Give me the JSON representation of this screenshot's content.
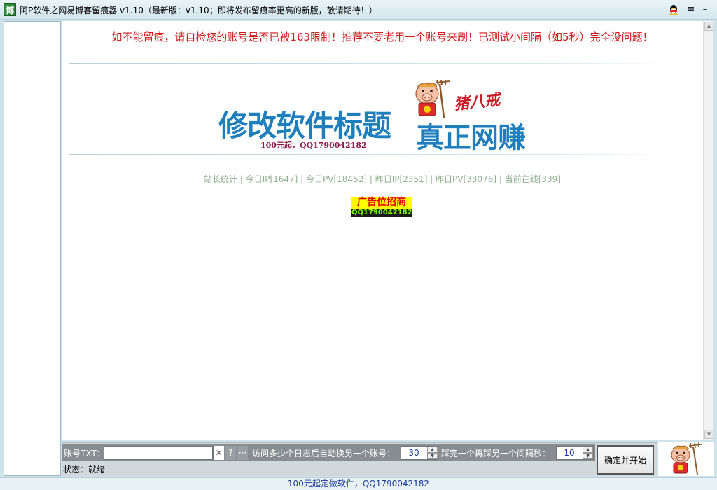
{
  "window": {
    "app_icon_glyph": "博",
    "title": "阿P软件之网易博客留痕器 v1.10（最新版：v1.10；即将发布留痕率更高的新版，敬请期待！）",
    "qq_icon": "qq-penguin-icon",
    "menu_icon": "menu-lines-icon",
    "minimize_icon": "minimize-icon"
  },
  "main": {
    "notice": "如不能留痕，请自检您的账号是否已被163限制！推荐不要老用一个账号来刷！已测试小间隔（如5秒）完全没问题！",
    "banner": {
      "title": "修改软件标题",
      "subtitle": "100元起，QQ1790042182",
      "slogan": "真正网赚",
      "brand": "猪八戒"
    },
    "stats": "站长统计 | 今日IP[1647] | 今日PV[18452] | 昨日IP[2351] | 昨日PV[33076] | 当前在线[339]",
    "ad": {
      "title": "广告位招商",
      "contact": "QQ1790042182"
    }
  },
  "controls": {
    "account_label": "账号TXT：",
    "account_value": "",
    "clear_btn": "✕",
    "help_btn": "?",
    "more_btn": "···",
    "switch_label": "访问多少个日志后自动换另一个账号：",
    "switch_value": "30",
    "interval_label": "踩完一个再踩另一个间隔秒：",
    "interval_value": "10",
    "status": "状态：就绪",
    "start_button": "确定并开始"
  },
  "footer": {
    "text": "100元起定做软件，QQ1790042182"
  },
  "colors": {
    "notice": "#d21b1b",
    "banner_blue": "#1f7fbd",
    "stats_green": "#8fb08f",
    "ad_yellow": "#ffff00",
    "footer_text": "#1a3a9a"
  }
}
